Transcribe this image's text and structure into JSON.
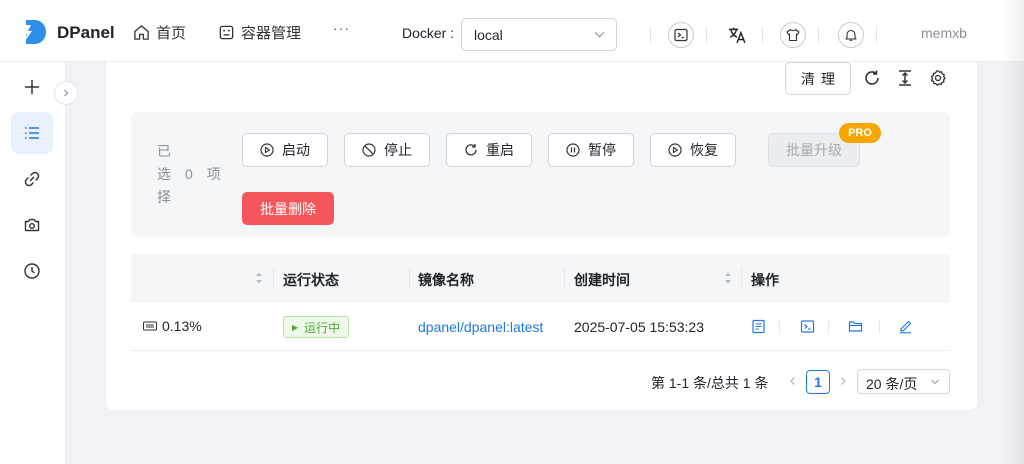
{
  "brand": {
    "name": "DPanel"
  },
  "nav": [
    {
      "label": "首页",
      "icon": "home-icon"
    },
    {
      "label": "容器管理",
      "icon": "container-icon"
    }
  ],
  "nav_more": "···",
  "docker": {
    "label": "Docker :",
    "value": "local"
  },
  "header_icons": [
    "terminal-icon",
    "translate-icon",
    "theme-shirt-icon",
    "bell-icon"
  ],
  "user": {
    "name": "memxb"
  },
  "sidebar": {
    "items": [
      {
        "icon": "plus-icon",
        "active": false
      },
      {
        "icon": "list-icon",
        "active": true
      },
      {
        "icon": "link-icon",
        "active": false
      },
      {
        "icon": "camera-icon",
        "active": false
      },
      {
        "icon": "clock-icon",
        "active": false
      }
    ]
  },
  "toolbar": {
    "clean_label": "清理"
  },
  "batch": {
    "selected_prefix": "已",
    "selected_word": "选",
    "selected_count": "0",
    "selected_unit": "项",
    "selected_suffix": "择",
    "buttons": [
      {
        "label": "启动",
        "icon": "play-icon"
      },
      {
        "label": "停止",
        "icon": "stop-icon"
      },
      {
        "label": "重启",
        "icon": "restart-icon"
      },
      {
        "label": "暂停",
        "icon": "pause-icon"
      },
      {
        "label": "恢复",
        "icon": "resume-icon"
      }
    ],
    "upgrade_label": "批量升级",
    "pro_badge": "PRO",
    "delete_label": "批量删除"
  },
  "table": {
    "headers": [
      "运行状态",
      "镜像名称",
      "创建时间",
      "操作"
    ],
    "rows": [
      {
        "cpu": "0.13%",
        "status": "运行中",
        "image": "dpanel/dpanel:latest",
        "created": "2025-07-05 15:53:23",
        "actions": [
          "details-icon",
          "terminal-icon",
          "folder-icon",
          "edit-icon"
        ]
      }
    ]
  },
  "pagination": {
    "total_text": "第 1-1 条/总共 1 条",
    "current_page": "1",
    "page_size": "20 条/页"
  },
  "colors": {
    "accent": "#1f7ae0",
    "danger": "#f5565b",
    "success": "#52a83a",
    "pro": "#f7a600"
  }
}
